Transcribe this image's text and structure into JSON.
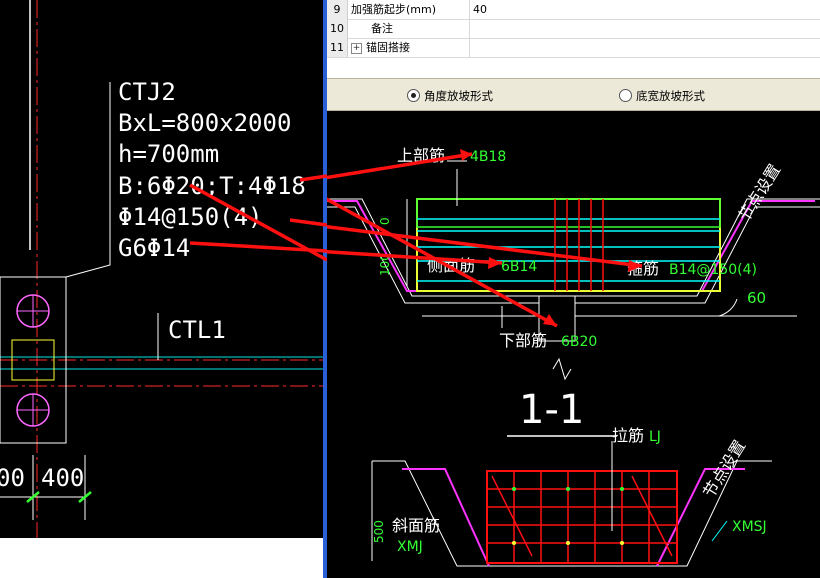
{
  "left_cad": {
    "label_lines": [
      "CTJ2",
      "BxL=800x2000",
      "h=700mm",
      "B:6Φ20;T:4Φ18",
      "Φ14@150(4)",
      "G6Φ14"
    ],
    "beam_label": "CTL1",
    "dims": [
      "00",
      "400"
    ]
  },
  "property_table": {
    "rows": [
      {
        "num": "9",
        "name": "加强筋起步(mm)",
        "value": "40"
      },
      {
        "num": "10",
        "name": "备注",
        "value": ""
      },
      {
        "num": "11",
        "name": "锚固搭接",
        "value": "",
        "expandable": true
      }
    ]
  },
  "slope_options": {
    "selected": "angle",
    "angle_label": "角度放坡形式",
    "width_label": "底宽放坡形式"
  },
  "section_1": {
    "top_bar_label": "上部筋",
    "top_bar_value": "4B18",
    "node_label": "节点设置",
    "side_bar_label": "侧面筋",
    "side_bar_value": "6B14",
    "stirrup_label": "箍筋",
    "stirrup_value": "B14@150(4)",
    "bottom_bar_label": "下部筋",
    "bottom_bar_value": "6B20",
    "angle": "60",
    "dim_a": "0",
    "dim_b": "100",
    "section_title": "1-1"
  },
  "section_2": {
    "tie_label": "拉筋",
    "tie_value": "LJ",
    "node_label": "节点设置",
    "slope_label": "斜面筋",
    "slope_left_value": "XMJ",
    "slope_right_value": "XMSJ",
    "dim": "500"
  },
  "colors": {
    "cad_background": "#000000",
    "leader_red": "#ff1010",
    "value_green": "#33ff33",
    "accent_magenta": "#ff33ff",
    "accent_cyan": "#00ffff",
    "accent_yellow": "#ffff33",
    "divider_blue": "#2b5fd8"
  }
}
